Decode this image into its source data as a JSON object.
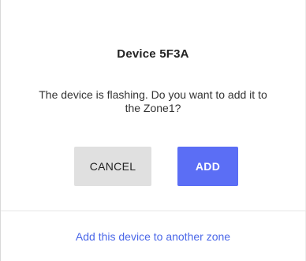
{
  "dialog": {
    "title": "Device 5F3A",
    "message": "The device is flashing. Do you want to add it to the Zone1?",
    "cancel_label": "CANCEL",
    "add_label": "ADD",
    "link_label": "Add this device to another zone"
  },
  "colors": {
    "accent": "#5b6ef5",
    "link": "#4a67e8",
    "cancel_bg": "#e0e0e0"
  }
}
